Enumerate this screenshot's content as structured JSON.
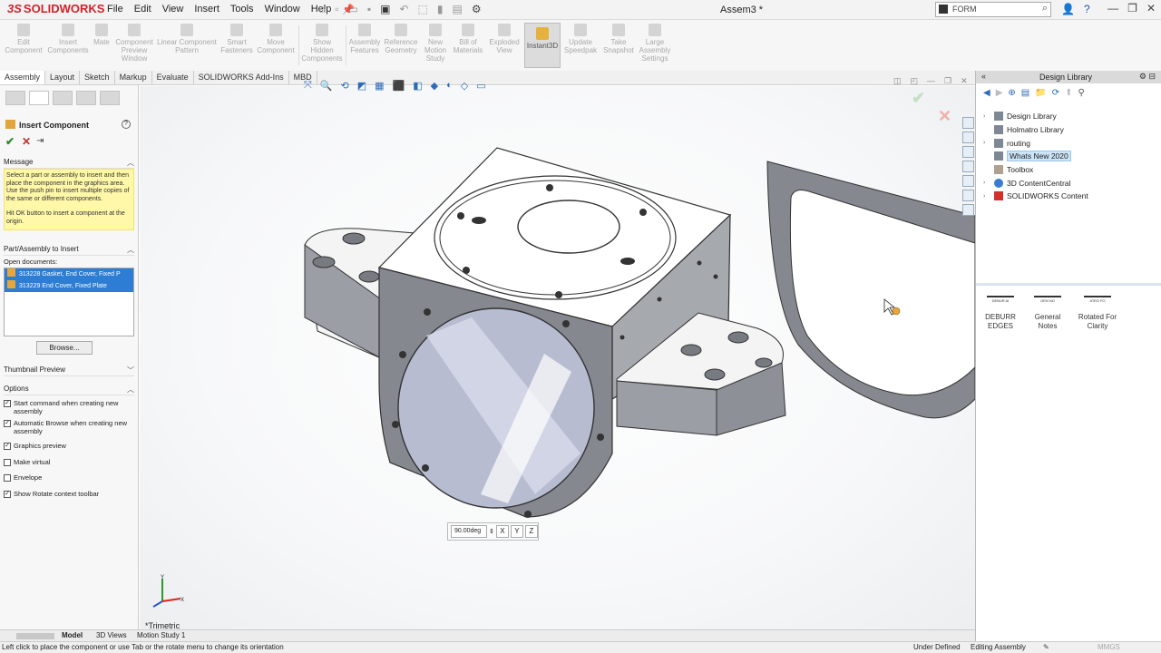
{
  "app": {
    "brand": "SOLIDWORKS",
    "brand_prefix": "3S",
    "doc_title": "Assem3 *",
    "search_placeholder": "FORM",
    "menus": [
      "File",
      "Edit",
      "View",
      "Insert",
      "Tools",
      "Window",
      "Help"
    ]
  },
  "command_manager": {
    "tools": [
      {
        "label": "Edit\nComponent"
      },
      {
        "label": "Insert\nComponents"
      },
      {
        "label": "Mate"
      },
      {
        "label": "Component\nPreview\nWindow"
      },
      {
        "label": "Linear Component\nPattern"
      },
      {
        "label": "Smart\nFasteners"
      },
      {
        "label": "Move\nComponent"
      },
      {
        "label": "Show\nHidden\nComponents"
      },
      {
        "label": "Assembly\nFeatures"
      },
      {
        "label": "Reference\nGeometry"
      },
      {
        "label": "New\nMotion\nStudy"
      },
      {
        "label": "Bill of\nMaterials"
      },
      {
        "label": "Exploded\nView"
      },
      {
        "label": "Instant3D"
      },
      {
        "label": "Update\nSpeedpak"
      },
      {
        "label": "Take\nSnapshot"
      },
      {
        "label": "Large\nAssembly\nSettings"
      }
    ],
    "tabs": [
      "Assembly",
      "Layout",
      "Sketch",
      "Markup",
      "Evaluate",
      "SOLIDWORKS Add-Ins",
      "MBD"
    ]
  },
  "property_manager": {
    "title": "Insert Component",
    "message_header": "Message",
    "message": "Select a part or assembly to insert and then place the component in the graphics area. Use the push pin to insert multiple copies of the same or different components.",
    "message2": "Hit OK button to insert a component at the origin.",
    "part_header": "Part/Assembly to Insert",
    "open_docs_label": "Open documents:",
    "open_docs": [
      "313228 Gasket, End Cover, Fixed P",
      "313229 End Cover, Fixed Plate"
    ],
    "browse_label": "Browse...",
    "thumbnail_header": "Thumbnail Preview",
    "options_header": "Options",
    "options": [
      {
        "label": "Start command when creating new assembly",
        "checked": true
      },
      {
        "label": "Automatic Browse when creating new assembly",
        "checked": true
      },
      {
        "label": "Graphics preview",
        "checked": true
      },
      {
        "label": "Make virtual",
        "checked": false
      },
      {
        "label": "Envelope",
        "checked": false
      },
      {
        "label": "Show Rotate context toolbar",
        "checked": true
      }
    ]
  },
  "graphics": {
    "rotate_value": "90.00deg",
    "view_name": "*Trimetric"
  },
  "bottom_tabs": [
    "Model",
    "3D Views",
    "Motion Study 1"
  ],
  "status": {
    "message": "Left click to place the component or use Tab or the rotate menu to change its orientation",
    "state": "Under Defined",
    "mode": "Editing Assembly",
    "units": "MMGS"
  },
  "design_library": {
    "title": "Design Library",
    "tree": [
      {
        "label": "Design Library",
        "expandable": true
      },
      {
        "label": "Holmatro Library",
        "expandable": false
      },
      {
        "label": "routing",
        "expandable": true
      },
      {
        "label": "Whats New 2020",
        "expandable": false,
        "selected": true
      },
      {
        "label": "Toolbox",
        "expandable": false
      },
      {
        "label": "3D ContentCentral",
        "expandable": true
      },
      {
        "label": "SOLIDWORKS Content",
        "expandable": true
      }
    ],
    "items": [
      {
        "label": "DEBURR\nEDGES",
        "thumb": "DEBUR AI"
      },
      {
        "label": "General\nNotes",
        "thumb": "GEN NO"
      },
      {
        "label": "Rotated For\nClarity",
        "thumb": "ATED FO"
      }
    ]
  }
}
